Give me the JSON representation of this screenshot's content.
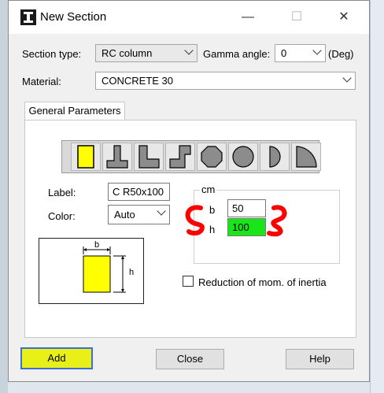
{
  "window": {
    "title": "New Section",
    "minimize_glyph": "—",
    "maximize_glyph": "☐",
    "close_glyph": "✕"
  },
  "form": {
    "section_type_label": "Section type:",
    "section_type_value": "RC column",
    "gamma_label": "Gamma angle:",
    "gamma_value": "0",
    "gamma_unit": "(Deg)",
    "material_label": "Material:",
    "material_value": "CONCRETE 30"
  },
  "tabs": {
    "general": "General Parameters"
  },
  "shapes": [
    "rectangle",
    "t-section",
    "l-section",
    "z-section",
    "octagon",
    "circle",
    "half-circle",
    "quarter-circle"
  ],
  "params": {
    "label_label": "Label:",
    "label_value": "C R50x100",
    "color_label": "Color:",
    "color_value": "Auto",
    "unit_group": "cm",
    "b_label": "b",
    "b_value": "50",
    "h_label": "h",
    "h_value": "100",
    "reduction_label": "Reduction of mom. of inertia"
  },
  "sketch": {
    "b": "b",
    "h": "h"
  },
  "buttons": {
    "add": "Add",
    "close": "Close",
    "help": "Help"
  },
  "colors": {
    "highlight": "#19e619",
    "section_fill": "#ffff00",
    "annotation": "#ff0000",
    "add_button_highlight": "#e8f018"
  }
}
